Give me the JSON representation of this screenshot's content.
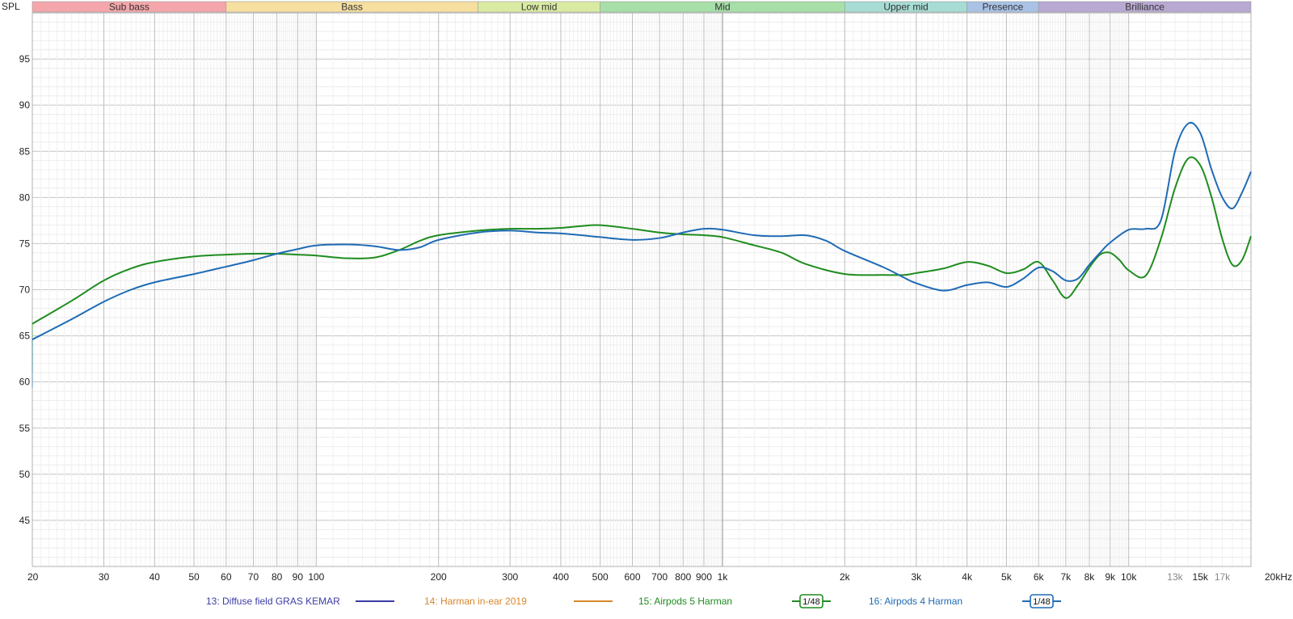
{
  "chart_data": {
    "type": "line",
    "ylabel": "SPL",
    "xunit": "kHz",
    "x_scale": "log",
    "xlim": [
      20,
      20000
    ],
    "ylim": [
      40,
      100
    ],
    "grid": true,
    "legend_placement": "bottom",
    "bands": [
      {
        "label": "Sub bass",
        "from": 20,
        "to": 60,
        "color": "#f4a6ab"
      },
      {
        "label": "Bass",
        "from": 60,
        "to": 250,
        "color": "#f7dfa0"
      },
      {
        "label": "Low mid",
        "from": 250,
        "to": 500,
        "color": "#d9eba2"
      },
      {
        "label": "Mid",
        "from": 500,
        "to": 2000,
        "color": "#a6dfa8"
      },
      {
        "label": "Upper mid",
        "from": 2000,
        "to": 4000,
        "color": "#a6dcd3"
      },
      {
        "label": "Presence",
        "from": 4000,
        "to": 6000,
        "color": "#a9c2e6"
      },
      {
        "label": "Brilliance",
        "from": 6000,
        "to": 20000,
        "color": "#b8a9d2"
      }
    ],
    "y_ticks": [
      45,
      50,
      55,
      60,
      65,
      70,
      75,
      80,
      85,
      90,
      95
    ],
    "x_ticks": [
      {
        "v": 20,
        "label": "20"
      },
      {
        "v": 30,
        "label": "30"
      },
      {
        "v": 40,
        "label": "40"
      },
      {
        "v": 50,
        "label": "50"
      },
      {
        "v": 60,
        "label": "60"
      },
      {
        "v": 70,
        "label": "70"
      },
      {
        "v": 80,
        "label": "80"
      },
      {
        "v": 90,
        "label": "90"
      },
      {
        "v": 100,
        "label": "100"
      },
      {
        "v": 200,
        "label": "200"
      },
      {
        "v": 300,
        "label": "300"
      },
      {
        "v": 400,
        "label": "400"
      },
      {
        "v": 500,
        "label": "500"
      },
      {
        "v": 600,
        "label": "600"
      },
      {
        "v": 700,
        "label": "700"
      },
      {
        "v": 800,
        "label": "800"
      },
      {
        "v": 900,
        "label": "900"
      },
      {
        "v": 1000,
        "label": "1k"
      },
      {
        "v": 2000,
        "label": "2k"
      },
      {
        "v": 3000,
        "label": "3k"
      },
      {
        "v": 4000,
        "label": "4k"
      },
      {
        "v": 5000,
        "label": "5k"
      },
      {
        "v": 6000,
        "label": "6k"
      },
      {
        "v": 7000,
        "label": "7k"
      },
      {
        "v": 8000,
        "label": "8k"
      },
      {
        "v": 9000,
        "label": "9k"
      },
      {
        "v": 10000,
        "label": "10k"
      },
      {
        "v": 13000,
        "label": "13k",
        "minor": true
      },
      {
        "v": 15000,
        "label": "15k"
      },
      {
        "v": 17000,
        "label": "17k",
        "minor": true
      },
      {
        "v": 20000,
        "label": "20kHz"
      }
    ],
    "series": [
      {
        "name": "13: Diffuse field GRAS KEMAR",
        "color": "#3b3ba6",
        "x": [],
        "y": []
      },
      {
        "name": "14: Harman in-ear 2019",
        "color": "#d8862a",
        "x": [],
        "y": []
      },
      {
        "name": "15: Airpods 5 Harman",
        "color": "#1e8c1e",
        "smoothing": "1/48",
        "x": [
          20,
          25,
          30,
          35,
          40,
          50,
          60,
          70,
          80,
          90,
          100,
          120,
          140,
          160,
          180,
          200,
          250,
          300,
          350,
          400,
          450,
          500,
          600,
          700,
          800,
          900,
          1000,
          1200,
          1400,
          1600,
          2000,
          2500,
          2800,
          3000,
          3500,
          4000,
          4500,
          5000,
          5500,
          6000,
          6500,
          7000,
          7500,
          8000,
          8500,
          9000,
          9500,
          10000,
          11000,
          12000,
          13000,
          14000,
          15000,
          16000,
          17000,
          18000,
          19000,
          20000
        ],
        "y": [
          66.3,
          68.8,
          71.0,
          72.3,
          73.0,
          73.6,
          73.8,
          73.9,
          73.9,
          73.8,
          73.7,
          73.4,
          73.5,
          74.3,
          75.3,
          75.9,
          76.4,
          76.6,
          76.6,
          76.7,
          76.9,
          77.0,
          76.6,
          76.2,
          76.0,
          75.9,
          75.7,
          74.8,
          74.0,
          72.8,
          71.7,
          71.6,
          71.6,
          71.8,
          72.3,
          73.0,
          72.6,
          71.8,
          72.2,
          73.0,
          71.0,
          69.1,
          70.5,
          72.4,
          73.8,
          74.0,
          73.2,
          72.1,
          71.5,
          75.5,
          81.0,
          84.2,
          83.5,
          80.0,
          75.5,
          72.7,
          73.2,
          75.8
        ]
      },
      {
        "name": "16: Airpods 4 Harman",
        "color": "#1f6bb5",
        "smoothing": "1/48",
        "x": [
          20,
          25,
          30,
          35,
          40,
          50,
          60,
          70,
          80,
          90,
          100,
          120,
          140,
          160,
          180,
          200,
          250,
          300,
          350,
          400,
          450,
          500,
          600,
          700,
          800,
          900,
          1000,
          1200,
          1400,
          1600,
          1800,
          2000,
          2500,
          2800,
          3000,
          3500,
          4000,
          4500,
          5000,
          5500,
          6000,
          6500,
          7000,
          7500,
          8000,
          8500,
          9000,
          10000,
          11000,
          12000,
          13000,
          14000,
          15000,
          16000,
          17000,
          18000,
          19000,
          20000
        ],
        "y": [
          64.6,
          66.8,
          68.7,
          70.0,
          70.8,
          71.7,
          72.5,
          73.2,
          73.9,
          74.4,
          74.8,
          74.9,
          74.7,
          74.3,
          74.6,
          75.4,
          76.2,
          76.4,
          76.2,
          76.1,
          75.9,
          75.7,
          75.4,
          75.6,
          76.2,
          76.6,
          76.5,
          75.9,
          75.8,
          75.9,
          75.3,
          74.2,
          72.4,
          71.3,
          70.7,
          69.9,
          70.5,
          70.8,
          70.3,
          71.2,
          72.4,
          72.0,
          71.0,
          71.2,
          72.7,
          74.0,
          75.1,
          76.5,
          76.6,
          77.5,
          85.0,
          88.0,
          87.0,
          83.0,
          80.0,
          78.8,
          80.5,
          82.8
        ]
      }
    ],
    "legend": [
      {
        "label": "13: Diffuse field GRAS KEMAR",
        "color": "#3b3ba6",
        "smoothing": ""
      },
      {
        "label": "14: Harman in-ear 2019",
        "color": "#d8862a",
        "smoothing": ""
      },
      {
        "label": "15: Airpods 5 Harman",
        "color": "#1e8c1e",
        "smoothing": "1/48"
      },
      {
        "label": "16: Airpods 4 Harman",
        "color": "#1f6bb5",
        "smoothing": "1/48"
      }
    ]
  }
}
